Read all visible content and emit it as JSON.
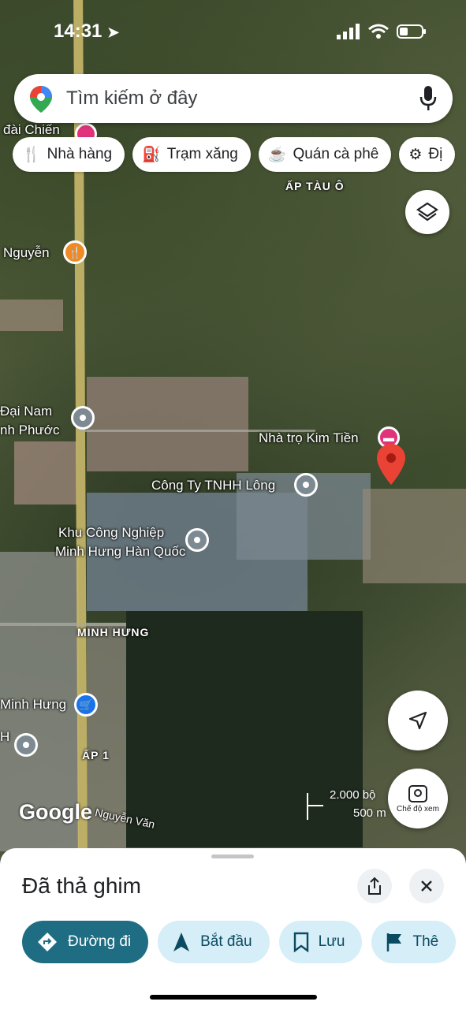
{
  "status_bar": {
    "time": "14:31"
  },
  "search": {
    "placeholder": "Tìm kiếm ở đây"
  },
  "chips": [
    {
      "label": "Nhà hàng",
      "icon": "fork-knife-icon"
    },
    {
      "label": "Trạm xăng",
      "icon": "fuel-pump-icon"
    },
    {
      "label": "Quán cà phê",
      "icon": "coffee-cup-icon"
    },
    {
      "label": "Đị",
      "icon": "landmark-icon"
    }
  ],
  "map": {
    "labels": {
      "tau_o": "ẤP TÀU Ô",
      "dai_chien": "đài Chiến",
      "nguyen": "Nguyễn",
      "dai_nam": "Đại Nam",
      "nh_phuoc": "nh Phước",
      "kim_tien": "Nhà trọ Kim Tiền",
      "tnhh_long": "Công Ty TNHH Lông",
      "kcn_1": "Khu Công Nghiệp",
      "kcn_2": "Minh Hưng Hàn Quốc",
      "minh_hung": "MINH HƯNG",
      "minh_hung_store": "Minh Hưng",
      "ap1": "ẤP 1",
      "nguyen_van": "Nguyễn Văn",
      "h": "H"
    },
    "google_logo": "Google",
    "scale": {
      "feet": "2.000 bộ",
      "meters": "500 m"
    },
    "street_view_label": "Chế độ xem"
  },
  "sheet": {
    "title": "Đã thả ghim",
    "actions": [
      {
        "label": "Đường đi",
        "icon": "directions-icon"
      },
      {
        "label": "Bắt đầu",
        "icon": "navigation-arrow-icon"
      },
      {
        "label": "Lưu",
        "icon": "bookmark-icon"
      },
      {
        "label": "Thê",
        "icon": "flag-icon"
      }
    ]
  },
  "colors": {
    "accent": "#1e6d82",
    "chip_bg": "#d6eef8",
    "pin_red": "#ea4335"
  }
}
